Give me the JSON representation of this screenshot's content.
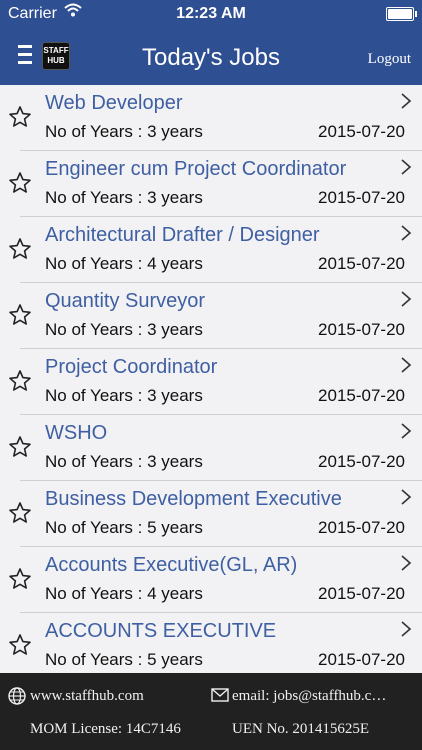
{
  "status_bar": {
    "carrier": "Carrier",
    "time": "12:23 AM"
  },
  "nav": {
    "title": "Today's Jobs",
    "logout_label": "Logout",
    "logo_text_top": "STAFF",
    "logo_text_bottom": "HUB"
  },
  "jobs": [
    {
      "title": "Web Developer",
      "years": "No of Years : 3 years",
      "date": "2015-07-20"
    },
    {
      "title": "Engineer cum Project Coordinator",
      "years": "No of Years : 3 years",
      "date": "2015-07-20"
    },
    {
      "title": "Architectural Drafter / Designer",
      "years": "No of Years : 4 years",
      "date": "2015-07-20"
    },
    {
      "title": "Quantity Surveyor",
      "years": "No of Years : 3 years",
      "date": "2015-07-20"
    },
    {
      "title": "Project Coordinator",
      "years": "No of Years : 3 years",
      "date": "2015-07-20"
    },
    {
      "title": "WSHO",
      "years": "No of Years : 3 years",
      "date": "2015-07-20"
    },
    {
      "title": "Business Development Executive",
      "years": "No of Years : 5 years",
      "date": "2015-07-20"
    },
    {
      "title": "Accounts Executive(GL, AR)",
      "years": "No of Years : 4 years",
      "date": "2015-07-20"
    },
    {
      "title": "ACCOUNTS EXECUTIVE",
      "years": "No of Years : 5 years",
      "date": "2015-07-20"
    }
  ],
  "footer": {
    "website": "www.staffhub.com",
    "email": "email: jobs@staffhub.c…",
    "license": "MOM License: 14C7146",
    "uen": "UEN No. 201415625E"
  },
  "colors": {
    "nav_bg": "#2f4f93",
    "job_title": "#3f5fa3",
    "footer_bg": "#212121"
  }
}
